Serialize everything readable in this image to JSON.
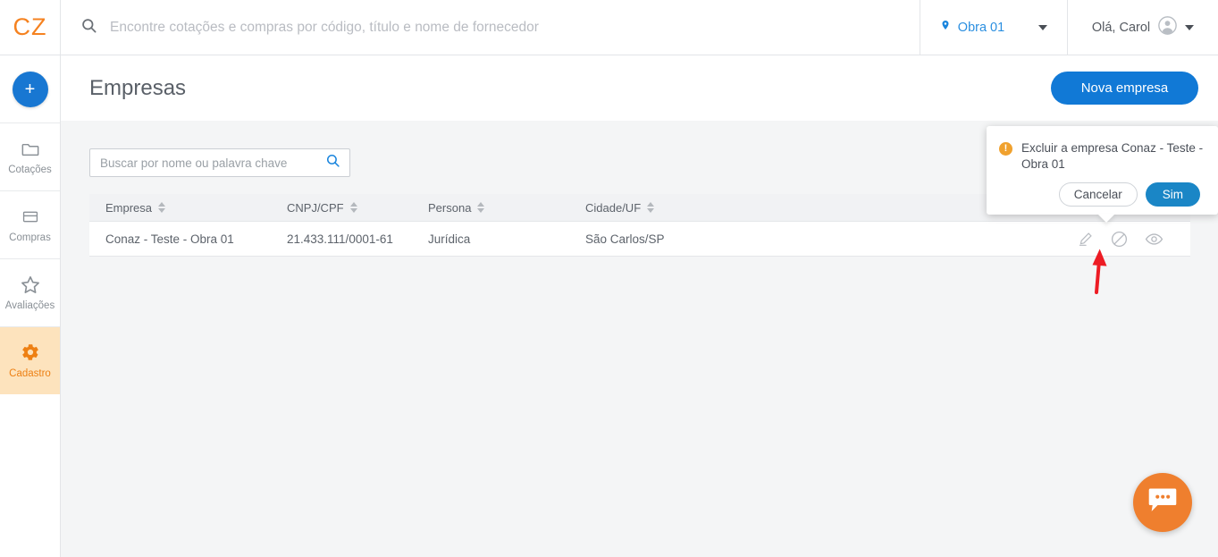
{
  "brand": {
    "logo_text": "CZ",
    "accent_orange": "#f58220",
    "accent_blue": "#1179d6"
  },
  "topbar": {
    "search_placeholder": "Encontre cotações e compras por código, título e nome de fornecedor",
    "search_icon": "search-icon",
    "obra": {
      "label": "Obra 01",
      "pin_icon": "location-pin-icon",
      "caret_icon": "chevron-down-icon"
    },
    "user": {
      "greeting": "Olá, Carol",
      "avatar_icon": "user-avatar-icon",
      "caret_icon": "chevron-down-icon"
    }
  },
  "sidebar": {
    "add_button": {
      "label": "+",
      "name": "add-button"
    },
    "items": [
      {
        "label": "Cotações",
        "icon": "folder-icon",
        "active": false
      },
      {
        "label": "Compras",
        "icon": "card-icon",
        "active": false
      },
      {
        "label": "Avaliações",
        "icon": "star-icon",
        "active": false
      },
      {
        "label": "Cadastro",
        "icon": "gear-icon",
        "active": true
      }
    ],
    "active_bg": "#fde3bd",
    "active_color": "#ed8014"
  },
  "page": {
    "title": "Empresas",
    "primary_button": "Nova empresa"
  },
  "filters": {
    "search_placeholder": "Buscar por nome ou palavra chave",
    "search_icon": "search-icon"
  },
  "table": {
    "columns": [
      {
        "label": "Empresa",
        "sortable": true
      },
      {
        "label": "CNPJ/CPF",
        "sortable": true
      },
      {
        "label": "Persona",
        "sortable": true
      },
      {
        "label": "Cidade/UF",
        "sortable": true
      },
      {
        "label": "",
        "sortable": false
      }
    ],
    "rows": [
      {
        "empresa": "Conaz - Teste - Obra 01",
        "cnpj": "21.433.111/0001-61",
        "persona": "Jurídica",
        "cidade": "São Carlos/SP",
        "actions": [
          "edit-icon",
          "block-icon",
          "view-icon"
        ]
      }
    ]
  },
  "popover": {
    "warning_icon": "warning-icon",
    "message": "Excluir a empresa Conaz - Teste - Obra 01",
    "cancel_label": "Cancelar",
    "confirm_label": "Sim",
    "confirm_color": "#1a86c6"
  },
  "annotation": {
    "arrow_icon": "red-arrow-up-icon",
    "color": "#ed1c24"
  },
  "chat": {
    "icon": "chat-bubble-icon",
    "color": "#ef7f2e"
  }
}
